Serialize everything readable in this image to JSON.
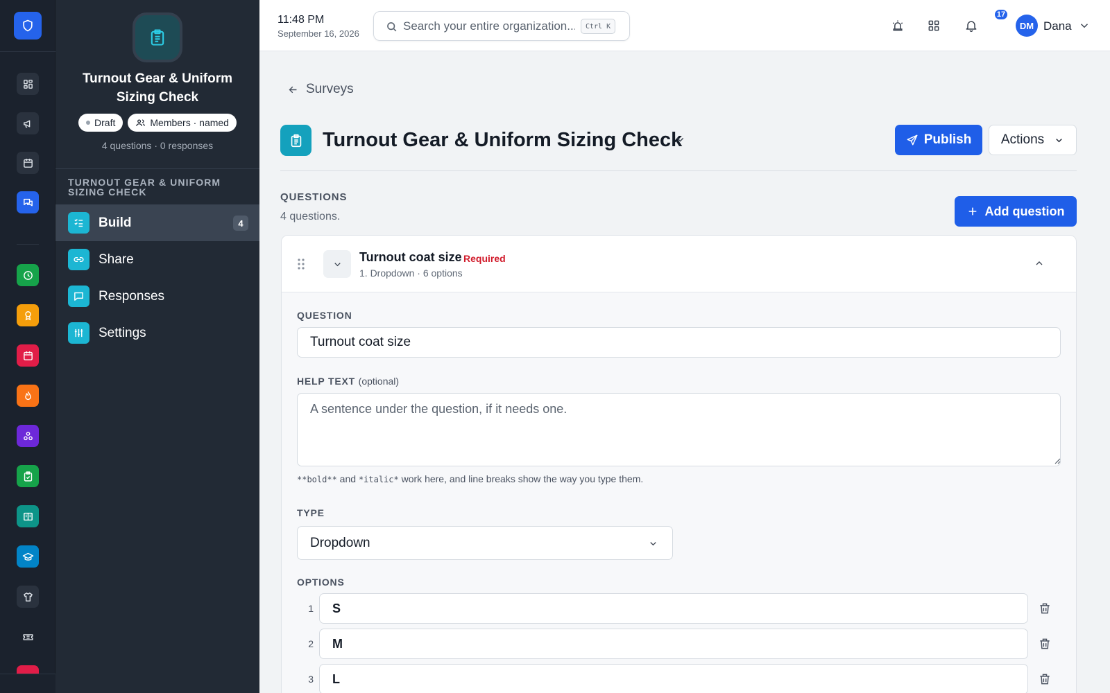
{
  "topbar": {
    "time": "11:48 PM",
    "date": "September 16, 2026",
    "search_placeholder": "Search your entire organization...",
    "search_shortcut": "Ctrl K",
    "notification_count": "17",
    "user_initials": "DM",
    "user_name": "Dana"
  },
  "sidebar": {
    "title": "Turnout Gear & Uniform Sizing Check",
    "status_pill": "Draft",
    "audience_pill": "Members · named",
    "meta": "4 questions · 0 responses",
    "section_label": "TURNOUT GEAR & UNIFORM SIZING CHECK",
    "nav": [
      {
        "label": "Build",
        "badge": "4",
        "icon": "list-check-icon",
        "active": true
      },
      {
        "label": "Share",
        "icon": "link-icon"
      },
      {
        "label": "Responses",
        "icon": "chat-icon"
      },
      {
        "label": "Settings",
        "icon": "sliders-icon"
      }
    ]
  },
  "rail": {
    "items": [
      {
        "icon": "dashboard-icon"
      },
      {
        "icon": "megaphone-icon"
      },
      {
        "icon": "calendar-icon"
      },
      {
        "icon": "messages-icon",
        "color": "#2563eb"
      },
      {
        "icon": "clock-icon",
        "color": "#16a34a"
      },
      {
        "icon": "award-icon",
        "color": "#f59e0b"
      },
      {
        "icon": "calendar-event-icon",
        "color": "#e11d48"
      },
      {
        "icon": "flame-icon",
        "color": "#f97316"
      },
      {
        "icon": "nodes-icon",
        "color": "#6d28d9"
      },
      {
        "icon": "clipboard-check-icon",
        "color": "#16a34a"
      },
      {
        "icon": "book-icon",
        "color": "#0d9488"
      },
      {
        "icon": "graduation-icon",
        "color": "#0284c7"
      },
      {
        "icon": "shirt-icon"
      },
      {
        "icon": "ticket-icon"
      }
    ]
  },
  "page": {
    "back_label": "Surveys",
    "title": "Turnout Gear & Uniform Sizing Check",
    "publish_label": "Publish",
    "actions_label": "Actions",
    "questions_heading": "QUESTIONS",
    "questions_count": "4 questions.",
    "add_question_label": "Add question"
  },
  "question": {
    "title": "Turnout coat size",
    "required_label": "Required",
    "meta": "1. Dropdown · 6 options",
    "question_label": "QUESTION",
    "question_value": "Turnout coat size",
    "help_label": "HELP TEXT",
    "help_optional": "(optional)",
    "help_placeholder": "A sentence under the question, if it needs one.",
    "help_note_bold": "**bold**",
    "help_note_and": " and ",
    "help_note_italic": "*italic*",
    "help_note_rest": " work here, and line breaks show the way you type them.",
    "type_label": "TYPE",
    "type_value": "Dropdown",
    "options_label": "OPTIONS",
    "options": [
      {
        "num": "1",
        "value": "S"
      },
      {
        "num": "2",
        "value": "M"
      },
      {
        "num": "3",
        "value": "L"
      }
    ]
  },
  "colors": {
    "accent": "#1f5ee8",
    "sidebar_bg": "#222a35",
    "rail_bg": "#1b222d",
    "nav_icon": "#1cb6d3",
    "required": "#d11a2a"
  }
}
